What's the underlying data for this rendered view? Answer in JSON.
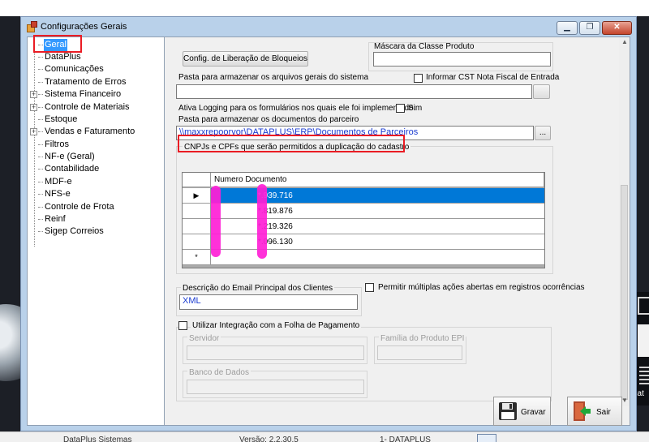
{
  "window": {
    "title": "Configurações Gerais"
  },
  "titlebar_buttons": {
    "minimize": "▁",
    "restore": "❐",
    "close": "✕"
  },
  "tree": {
    "items": [
      {
        "label": "Geral",
        "selected": true,
        "expandable": false
      },
      {
        "label": "DataPlus",
        "expandable": false
      },
      {
        "label": "Comunicações",
        "expandable": false
      },
      {
        "label": "Tratamento de Erros",
        "expandable": false
      },
      {
        "label": "Sistema Financeiro",
        "expandable": true
      },
      {
        "label": "Controle de Materiais",
        "expandable": true
      },
      {
        "label": "Estoque",
        "expandable": false
      },
      {
        "label": "Vendas e Faturamento",
        "expandable": true
      },
      {
        "label": "Filtros",
        "expandable": false
      },
      {
        "label": "NF-e (Geral)",
        "expandable": false
      },
      {
        "label": "Contabilidade",
        "expandable": false
      },
      {
        "label": "MDF-e",
        "expandable": false
      },
      {
        "label": "NFS-e",
        "expandable": false
      },
      {
        "label": "Controle de Frota",
        "expandable": false
      },
      {
        "label": "Reinf",
        "expandable": false
      },
      {
        "label": "Sigep Correios",
        "expandable": false
      }
    ],
    "expander_symbol": "+"
  },
  "form": {
    "liberacao_button": "Config. de Liberação de Bloqueios",
    "mascara_label": "Máscara da Classe Produto",
    "mascara_value": "",
    "pasta_gerais_label": "Pasta para armazenar os arquivos gerais do sistema",
    "pasta_gerais_value": "",
    "informar_cst_label": "Informar CST Nota Fiscal de Entrada",
    "logging_label": "Ativa Logging para os formulários nos quais ele foi implementado:",
    "logging_sim": "Sim",
    "pasta_parceiro_label": "Pasta para armazenar os documentos do parceiro",
    "pasta_parceiro_value": "\\\\maxxrepoorvor\\DATAPLUS\\ERP\\Documentos de Parceiros",
    "browse_label": "...",
    "cnpj_group_label": "CNPJs e CPFs que serão permitidos a duplicação do cadastro",
    "grid": {
      "header": "Numero Documento",
      "rows": [
        "*.939.716",
        "*.819.876",
        "*.219.326",
        "*.096.130"
      ],
      "current_row_marker": "▶",
      "new_row_marker": "*"
    },
    "email_label": "Descrição do Email Principal dos Clientes",
    "email_value": "XML",
    "permitir_label": "Permitir múltiplas ações abertas em registros ocorrências",
    "folha_label": "Utilizar Integração com a Folha de Pagamento",
    "servidor_label": "Servidor",
    "familia_label": "Família do Produto EPI",
    "banco_label": "Banco de Dados"
  },
  "actions": {
    "gravar": "Gravar",
    "sair": "Sair"
  },
  "statusbar": {
    "app": "DataPlus Sistemas",
    "version": "Versão: 2.2.30.5",
    "company": "1- DATAPLUS"
  },
  "desktop_edge_text": "dat",
  "colors": {
    "accent": "#0078d7",
    "tree_selection": "#3399ff",
    "highlight_red": "#ea1c24",
    "redaction": "#ff1fd6"
  }
}
